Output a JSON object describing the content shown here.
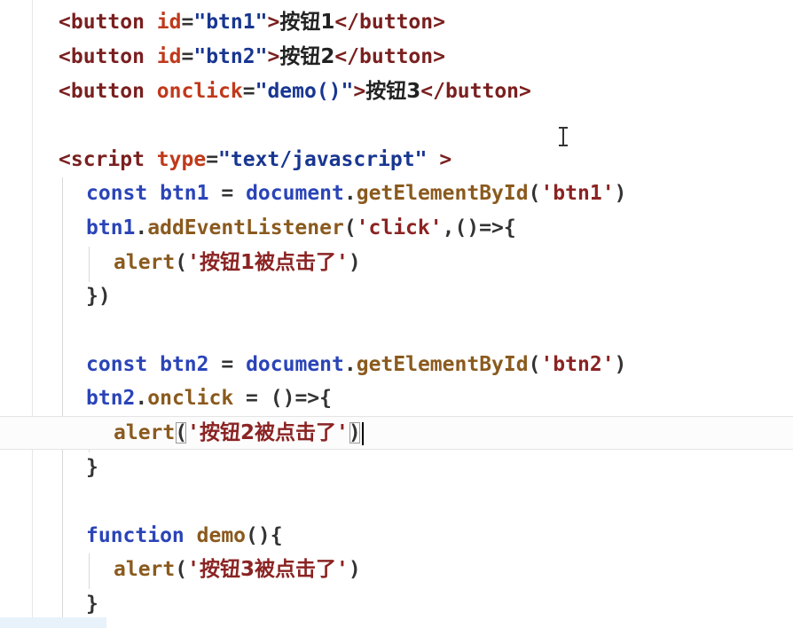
{
  "lines": {
    "l1": {
      "t1": "<button",
      "t2": "id",
      "t3": "=",
      "t4": "\"btn1\"",
      "t5": ">",
      "t6": "按钮1",
      "t7": "</button>"
    },
    "l2": {
      "t1": "<button",
      "t2": "id",
      "t3": "=",
      "t4": "\"btn2\"",
      "t5": ">",
      "t6": "按钮2",
      "t7": "</button>"
    },
    "l3": {
      "t1": "<button",
      "t2": "onclick",
      "t3": "=",
      "t4": "\"demo()\"",
      "t5": ">",
      "t6": "按钮3",
      "t7": "</button>"
    },
    "l5": {
      "t1": "<script",
      "t2": "type",
      "t3": "=",
      "t4": "\"text/javascript\"",
      "t5": ">"
    },
    "l6": {
      "t1": "const",
      "t2": "btn1",
      "t3": "=",
      "t4": "document",
      "t5": ".",
      "t6": "getElementById",
      "t7": "(",
      "t8": "'btn1'",
      "t9": ")"
    },
    "l7": {
      "t1": "btn1",
      "t2": ".",
      "t3": "addEventListener",
      "t4": "(",
      "t5": "'click'",
      "t6": ",()=>{"
    },
    "l8": {
      "t1": "alert",
      "t2": "(",
      "t3": "'",
      "t4": "按钮1被点击了",
      "t5": "'",
      "t6": ")"
    },
    "l9": {
      "t1": "})"
    },
    "l11": {
      "t1": "const",
      "t2": "btn2",
      "t3": "=",
      "t4": "document",
      "t5": ".",
      "t6": "getElementById",
      "t7": "(",
      "t8": "'btn2'",
      "t9": ")"
    },
    "l12": {
      "t1": "btn2",
      "t2": ".",
      "t3": "onclick",
      "t4": "=",
      "t5": "()=>{"
    },
    "l13": {
      "t1": "alert",
      "t2": "(",
      "t3": "'",
      "t4": "按钮2被点击了",
      "t5": "'",
      "t6": ")"
    },
    "l14": {
      "t1": "}"
    },
    "l16": {
      "t1": "function",
      "t2": "demo",
      "t3": "(){"
    },
    "l17": {
      "t1": "alert",
      "t2": "(",
      "t3": "'",
      "t4": "按钮3被点击了",
      "t5": "'",
      "t6": ")"
    },
    "l18": {
      "t1": "}"
    }
  },
  "colors": {
    "tag": "#7a1f1f",
    "attribute": "#c0391b",
    "string": "#183691",
    "keyword": "#2a44b8",
    "function": "#8a5a1e",
    "js_string": "#8b2323"
  }
}
